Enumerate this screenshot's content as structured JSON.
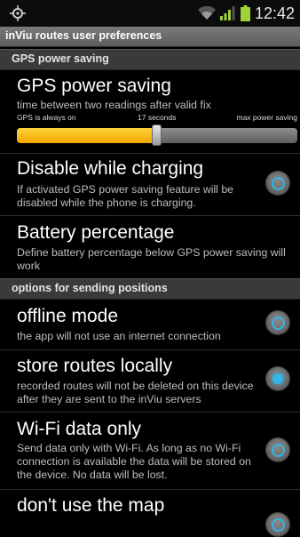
{
  "status_bar": {
    "left_icon": "gps-icon",
    "wifi_icon": "wifi-icon",
    "signal_icon": "signal-icon",
    "battery_icon": "battery-icon",
    "time": "12:42"
  },
  "app": {
    "title": "inViu routes user preferences"
  },
  "sections": [
    {
      "header": "GPS power saving",
      "items": [
        {
          "title": "GPS power saving",
          "summary": "time between two readings after valid fix",
          "slider": {
            "min_label": "GPS is always on",
            "value_label": "17 seconds",
            "max_label": "max power saving",
            "fraction": 0.5
          }
        },
        {
          "title": "Disable while charging",
          "summary": "If activated GPS power saving feature will be disabled while the phone is charging.",
          "checked": false
        },
        {
          "title": "Battery percentage",
          "summary": "Define battery percentage below GPS power saving will work"
        }
      ]
    },
    {
      "header": "options for sending positions",
      "items": [
        {
          "title": "offline mode",
          "summary": "the app will not use an internet connection",
          "checked": false
        },
        {
          "title": "store routes locally",
          "summary": "recorded routes will not be deleted on this device after they are sent to the inViu servers",
          "checked": true
        },
        {
          "title": "Wi-Fi data only",
          "summary": "Send data only with Wi-Fi. As long as no Wi-Fi connection is available the data will be stored on the device. No data will be lost.",
          "checked": false
        },
        {
          "title": "don't use the map",
          "summary": ""
        }
      ]
    }
  ],
  "colors": {
    "accent": "#33b5e5",
    "slider_fill": "#f6b400",
    "title_bar": "#6b6b6b",
    "section_header": "#3a3a3a"
  }
}
